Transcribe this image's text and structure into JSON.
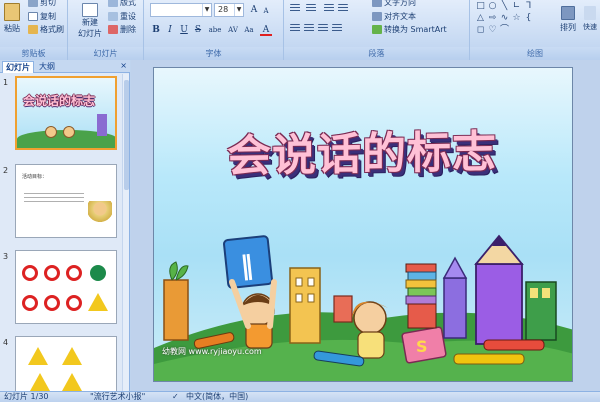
{
  "ribbon": {
    "clipboard": {
      "label": "剪贴板",
      "paste": "粘贴",
      "cut": "剪切",
      "copy": "复制",
      "format_painter": "格式刷"
    },
    "slides": {
      "label": "幻灯片",
      "new_slide": "新建",
      "new_slide_2": "幻灯片",
      "layout": "版式",
      "reset": "重设",
      "delete": "删除"
    },
    "font": {
      "label": "字体",
      "font_name": "",
      "font_size": "28",
      "bold": "B",
      "italic": "I",
      "underline": "U",
      "strike": "S",
      "shadow": "abe",
      "spacing": "AV",
      "case": "Aa",
      "color": "A"
    },
    "paragraph": {
      "label": "段落",
      "text_direction": "文字方向",
      "align_text": "对齐文本",
      "smartart": "转换为 SmartArt"
    },
    "drawing": {
      "label": "绘图",
      "arrange": "排列",
      "quick_styles": "快速"
    }
  },
  "panel": {
    "tab_slides": "幻灯片",
    "tab_outline": "大纲",
    "thumbnails": [
      {
        "num": "1",
        "title": "会说话的标志"
      },
      {
        "num": "2",
        "title": "活动目标："
      },
      {
        "num": "3",
        "title": ""
      },
      {
        "num": "4",
        "title": ""
      }
    ]
  },
  "slide": {
    "title": "会说话的标志",
    "watermark": "幼教网 www.ryjiaoyu.com",
    "sign_text": "‖"
  },
  "status": {
    "slide_count": "幻灯片 1/30",
    "theme": "\"流行艺术小报\"",
    "language": "中文(简体，中国)"
  },
  "colors": {
    "ribbon": "#c7daf3",
    "title_fill": "#ffc1d6",
    "title_outline": "#7a2a53",
    "selection": "#f0a030"
  }
}
